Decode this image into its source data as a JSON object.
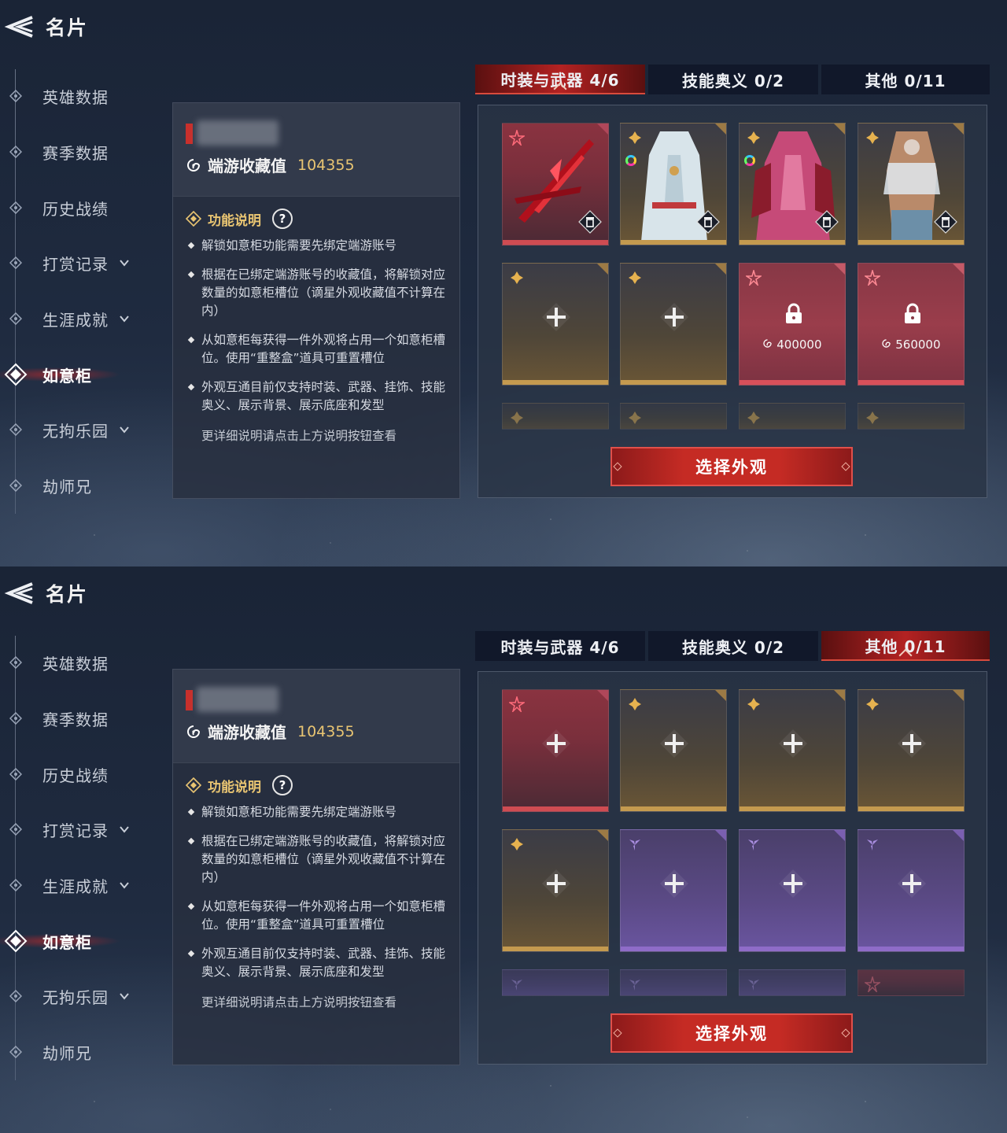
{
  "screens": [
    {
      "title": "名片",
      "sidebar": [
        "英雄数据",
        "赛季数据",
        "历史战绩",
        "打赏记录",
        "生涯成就",
        "如意柜",
        "无拘乐园",
        "劫师兄"
      ],
      "collection": {
        "label": "端游收藏值",
        "value": "104355"
      },
      "func_title": "功能说明",
      "help": "?",
      "bullets": [
        "解锁如意柜功能需要先绑定端游账号",
        "根据在已绑定端游账号的收藏值，将解锁对应数量的如意柜槽位（谪星外观收藏值不计算在内）",
        "从如意柜每获得一件外观将占用一个如意柜槽位。使用“重整盒”道具可重置槽位",
        "外观互通目前仅支持时装、武器、挂饰、技能奥义、展示背景、展示底座和发型"
      ],
      "more": "更详细说明请点击上方说明按钮查看",
      "tabs": [
        "时装与武器 4/6",
        "技能奥义 0/2",
        "其他 0/11"
      ],
      "active_tab": 0,
      "slot_prices": [
        "400000",
        "560000"
      ],
      "button": "选择外观"
    },
    {
      "title": "名片",
      "sidebar": [
        "英雄数据",
        "赛季数据",
        "历史战绩",
        "打赏记录",
        "生涯成就",
        "如意柜",
        "无拘乐园",
        "劫师兄"
      ],
      "collection": {
        "label": "端游收藏值",
        "value": "104355"
      },
      "func_title": "功能说明",
      "help": "?",
      "bullets": [
        "解锁如意柜功能需要先绑定端游账号",
        "根据在已绑定端游账号的收藏值，将解锁对应数量的如意柜槽位（谪星外观收藏值不计算在内）",
        "从如意柜每获得一件外观将占用一个如意柜槽位。使用“重整盒”道具可重置槽位",
        "外观互通目前仅支持时装、武器、挂饰、技能奥义、展示背景、展示底座和发型"
      ],
      "more": "更详细说明请点击上方说明按钮查看",
      "tabs": [
        "时装与武器 4/6",
        "技能奥义 0/2",
        "其他 0/11"
      ],
      "active_tab": 2,
      "button": "选择外观"
    }
  ],
  "icons": {
    "back": "back-arrow-icon",
    "collection": "swirl-icon",
    "func": "diamond-icon",
    "lock": "lock-icon",
    "trash": "trash-icon",
    "plus": "plus-icon"
  },
  "colors": {
    "accent_red": "#c8302c",
    "gold_text": "#e9c572",
    "rarity_red": "#cf4c52",
    "rarity_gold": "#c49a4f",
    "rarity_purple": "#8f6cc8"
  }
}
